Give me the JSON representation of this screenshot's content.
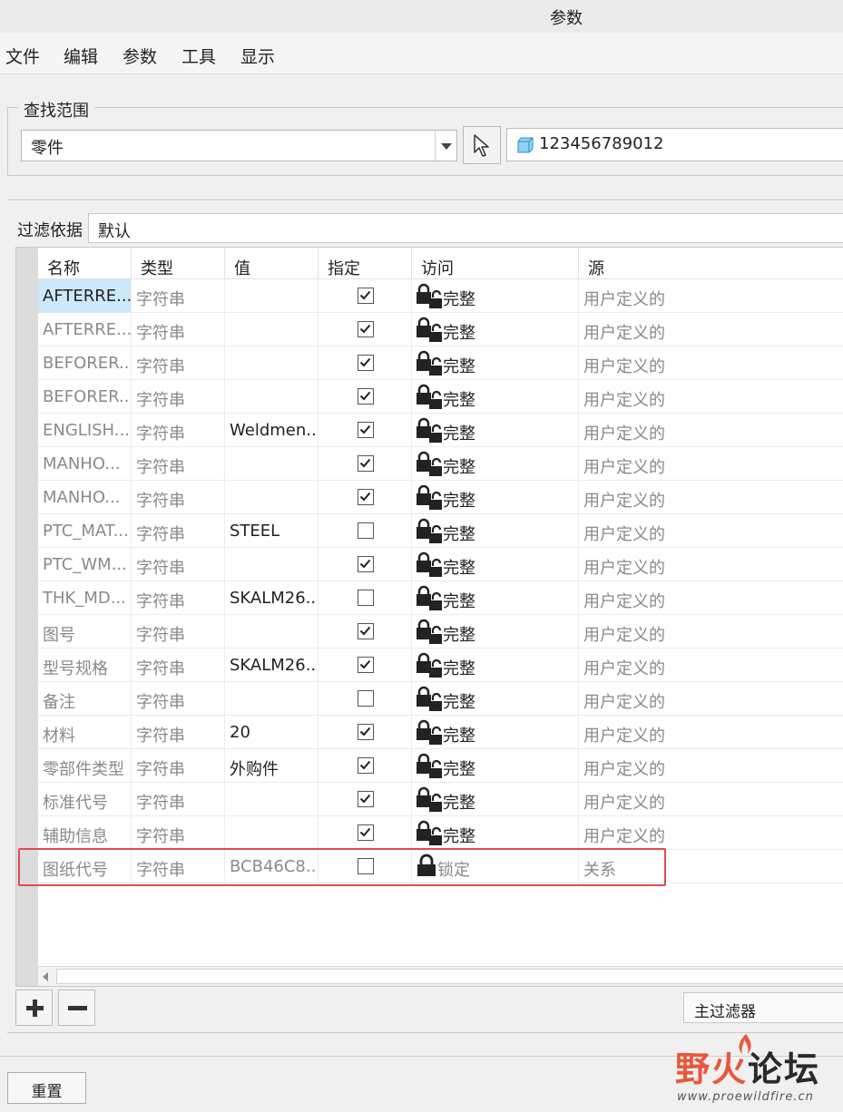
{
  "window": {
    "title": "参数"
  },
  "menu": [
    "文件",
    "编辑",
    "参数",
    "工具",
    "显示"
  ],
  "search_scope": {
    "legend": "查找范围",
    "type_value": "零件",
    "model_name": "123456789012"
  },
  "filter": {
    "label": "过滤依据",
    "value": "默认"
  },
  "table": {
    "columns": [
      "名称",
      "类型",
      "值",
      "指定",
      "访问",
      "源"
    ],
    "rows": [
      {
        "name": "AFTERRE...",
        "type": "字符串",
        "value": "",
        "designated": true,
        "access": "完整",
        "source": "用户定义的"
      },
      {
        "name": "AFTERRE...",
        "type": "字符串",
        "value": "",
        "designated": true,
        "access": "完整",
        "source": "用户定义的"
      },
      {
        "name": "BEFORER...",
        "type": "字符串",
        "value": "",
        "designated": true,
        "access": "完整",
        "source": "用户定义的"
      },
      {
        "name": "BEFORER...",
        "type": "字符串",
        "value": "",
        "designated": true,
        "access": "完整",
        "source": "用户定义的"
      },
      {
        "name": "ENGLISH...",
        "type": "字符串",
        "value": "Weldmen...",
        "designated": true,
        "access": "完整",
        "source": "用户定义的"
      },
      {
        "name": "MANHO...",
        "type": "字符串",
        "value": "",
        "designated": true,
        "access": "完整",
        "source": "用户定义的"
      },
      {
        "name": "MANHO...",
        "type": "字符串",
        "value": "",
        "designated": true,
        "access": "完整",
        "source": "用户定义的"
      },
      {
        "name": "PTC_MAT...",
        "type": "字符串",
        "value": "STEEL",
        "designated": false,
        "access": "完整",
        "source": "用户定义的"
      },
      {
        "name": "PTC_WM...",
        "type": "字符串",
        "value": "",
        "designated": true,
        "access": "完整",
        "source": "用户定义的"
      },
      {
        "name": "THK_MD...",
        "type": "字符串",
        "value": "SKALM26...",
        "designated": false,
        "access": "完整",
        "source": "用户定义的"
      },
      {
        "name": "图号",
        "type": "字符串",
        "value": "",
        "designated": true,
        "access": "完整",
        "source": "用户定义的"
      },
      {
        "name": "型号规格",
        "type": "字符串",
        "value": "SKALM26...",
        "designated": true,
        "access": "完整",
        "source": "用户定义的"
      },
      {
        "name": "备注",
        "type": "字符串",
        "value": "",
        "designated": false,
        "access": "完整",
        "source": "用户定义的"
      },
      {
        "name": "材料",
        "type": "字符串",
        "value": "20",
        "designated": true,
        "access": "完整",
        "source": "用户定义的"
      },
      {
        "name": "零部件类型",
        "type": "字符串",
        "value": "外购件",
        "designated": true,
        "access": "完整",
        "source": "用户定义的"
      },
      {
        "name": "标准代号",
        "type": "字符串",
        "value": "",
        "designated": true,
        "access": "完整",
        "source": "用户定义的"
      },
      {
        "name": "辅助信息",
        "type": "字符串",
        "value": "",
        "designated": true,
        "access": "完整",
        "source": "用户定义的"
      },
      {
        "name": "图纸代号",
        "type": "字符串",
        "value": "BCB46C8...",
        "designated": false,
        "access": "锁定",
        "source": "关系",
        "locked": true
      }
    ]
  },
  "toolbar": {
    "add_symbol": "+",
    "remove_symbol": "−",
    "master_filter_label": "主过滤器"
  },
  "footer": {
    "reset_label": "重置"
  },
  "watermark": {
    "brand_red": "野火",
    "brand_dark": "论坛",
    "url": "www.proewildfire.cn"
  },
  "colors": {
    "selection": "#cde8fa",
    "highlight_box": "#e04b4b",
    "watermark_red": "#e8583b"
  }
}
